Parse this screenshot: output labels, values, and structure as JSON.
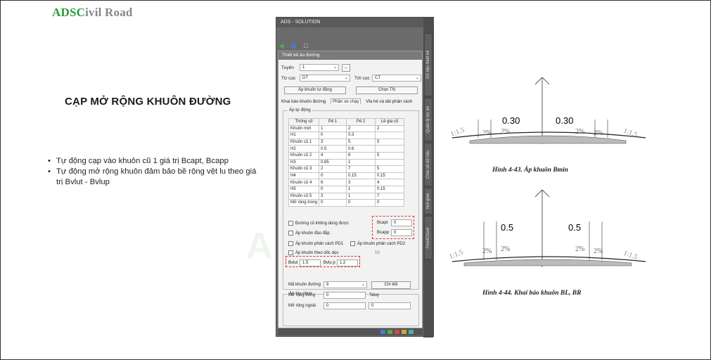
{
  "logo": {
    "part1": "ADSC",
    "part2": "ivil Road"
  },
  "slide": {
    "title": "CẠP MỞ RỘNG KHUÔN ĐƯỜNG",
    "bullets": [
      "Tự động cạp vào khuôn cũ 1 giá trị Bcapt, Bcapp",
      "Tự động mở rộng khuôn đảm bảo bề rộng vệt lu theo giá trị Bvlut - Bvlup"
    ]
  },
  "watermark": "ADS",
  "panel": {
    "title": "ADS - SOLUTION",
    "side_tabs": [
      "Dữ liệu thiết kế",
      "Quản lý dự án",
      "Chia sẻ dữ liệu",
      "Nút giao",
      "PointCloud"
    ],
    "header": "Thiết kế áo đường",
    "tuyen_label": "Tuyến",
    "tuyen_value": "1",
    "more_btn": "...",
    "tucoc_label": "Từ cọc",
    "tucoc_value": "DT",
    "toicoc_label": "Tới cọc",
    "toicoc_value": "CT",
    "btn_auto": "Áp khuôn tự động",
    "btn_choose": "Chọn TN",
    "tabs": [
      "Khai báo khuôn đường",
      "Phần xe chạy",
      "Vỉa hè và dải phân cách"
    ],
    "group_auto": "Áp tự động",
    "table": {
      "headers": [
        "Thông số",
        "Pd 1",
        "Pd 2",
        "Lề gia cố"
      ],
      "rows": [
        [
          "Khuôn mới",
          "1",
          "2",
          "2"
        ],
        [
          "H1",
          "0",
          "0.3",
          ""
        ],
        [
          "Khuôn cũ 1",
          "3",
          "5",
          "5"
        ],
        [
          "H2",
          "0.5",
          "0.6",
          ""
        ],
        [
          "Khuôn cũ 2",
          "4",
          "6",
          "5"
        ],
        [
          "H3",
          "0.85",
          "1",
          ""
        ],
        [
          "Khuôn cũ 3",
          "2",
          "7",
          "5"
        ],
        [
          "H4",
          "0",
          "0.15",
          "0.15"
        ],
        [
          "Khuôn cũ 4",
          "6",
          "3",
          "4"
        ],
        [
          "H5",
          "0",
          "1",
          "0.15"
        ],
        [
          "Khuôn cũ 5",
          "3",
          "1",
          "7"
        ],
        [
          "Mở rộng trong",
          "0",
          "0",
          "0"
        ]
      ]
    },
    "chk_old_unused": "Đường cũ không dùng được",
    "chk_cut_fill": "Áp khuôn đào đắp",
    "chk_pd1": "Áp khuôn phân cách PD1",
    "chk_pd2": "Áp khuôn phân cách PD2",
    "chk_slope": "Áp khuôn theo dốc dọc",
    "slope_val": "10",
    "bcapt_label": "Bcapt",
    "bcapt_value": "0",
    "bcapp_label": "Bcapp",
    "bcapp_value": "0",
    "bvlut_label": "Bvlut",
    "bvlut_value": "1.5",
    "bvlup_label": "Bvlu p",
    "bvlup_value": "1.2",
    "group_custom": "Áp tùy chọn",
    "ma_khuon_label": "Mã khuôn đường",
    "ma_khuon_value": "9",
    "btn_detail": "Chi tiết",
    "mo_rong_trong_label": "Mở rộng trong",
    "mo_rong_trong_value": "0",
    "taluy_label": "Taluy",
    "mo_rong_ngoai_label": "Mở rộng ngoài",
    "mo_rong_ngoai_value": "0",
    "taluy_value": "0"
  },
  "drawing1": {
    "left_dim": "0.30",
    "right_dim": "0.30",
    "slope_pct": "2%",
    "side_slope": "1:1.5",
    "caption": "Hình 4-43. Áp khuôn Bmin"
  },
  "drawing2": {
    "left_dim": "0.5",
    "right_dim": "0.5",
    "slope_pct": "2%",
    "side_slope": "1:1.5",
    "caption": "Hình 4-44. Khai báo khuôn BL, BR"
  }
}
